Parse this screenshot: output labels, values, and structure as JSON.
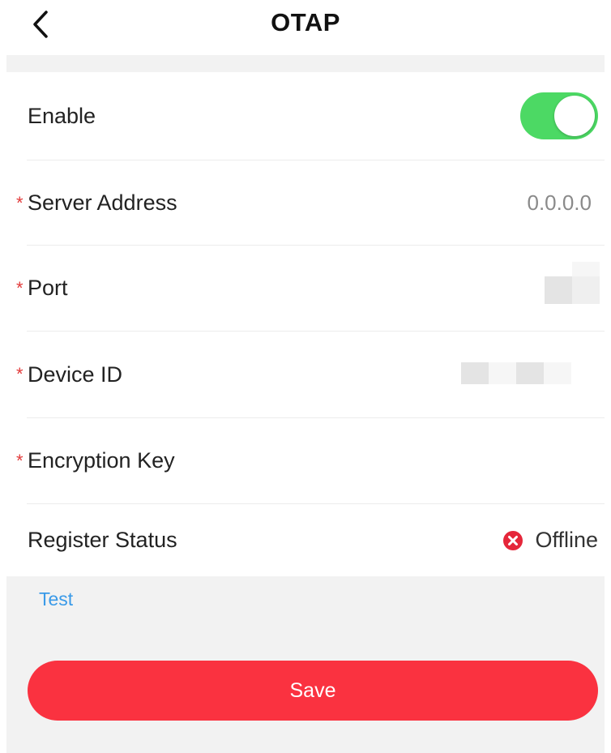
{
  "header": {
    "title": "OTAP",
    "back_icon": "chevron-left-icon"
  },
  "form": {
    "enable": {
      "label": "Enable",
      "enabled": true,
      "toggle_color": "#4cd964"
    },
    "server_address": {
      "label": "Server Address",
      "required_mark": "*",
      "value": "0.0.0.0"
    },
    "port": {
      "label": "Port",
      "required_mark": "*"
    },
    "device_id": {
      "label": "Device ID",
      "required_mark": "*"
    },
    "encryption_key": {
      "label": "Encryption Key",
      "required_mark": "*"
    },
    "register_status": {
      "label": "Register Status",
      "value": "Offline",
      "status_icon": "error-circle-icon",
      "status_color": "#e5263a"
    }
  },
  "actions": {
    "test_label": "Test",
    "save_label": "Save"
  },
  "colors": {
    "accent_red": "#fa3240",
    "link_blue": "#3a9ae8",
    "required_red": "#e23b3b"
  }
}
